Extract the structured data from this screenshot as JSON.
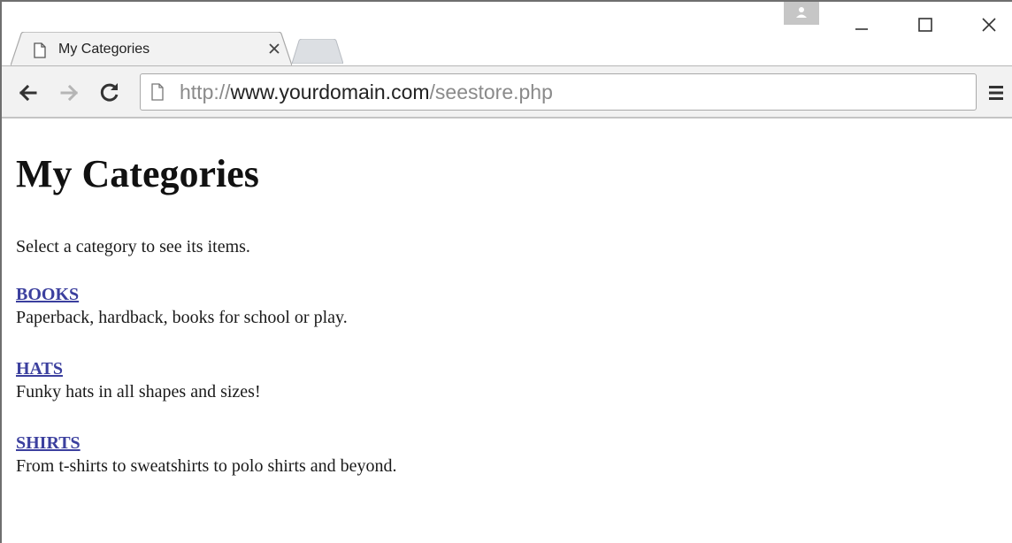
{
  "browser": {
    "tab_title": "My Categories",
    "url": {
      "scheme": "http://",
      "host": "www.yourdomain.com",
      "path": "/seestore.php"
    }
  },
  "page": {
    "title": "My Categories",
    "intro": "Select a category to see its items.",
    "categories": [
      {
        "name": "BOOKS",
        "description": "Paperback, hardback, books for school or play."
      },
      {
        "name": "HATS",
        "description": "Funky hats in all shapes and sizes!"
      },
      {
        "name": "SHIRTS",
        "description": "From t-shirts to sweatshirts to polo shirts and beyond."
      }
    ]
  },
  "colors": {
    "link": "#3b3f9e",
    "toolbar_bg": "#f2f2f2",
    "text": "#1a1a1a"
  },
  "icons": {
    "tab_page": "page-icon",
    "tab_close": "close-icon",
    "profile": "user-icon",
    "minimize": "minimize-icon",
    "maximize": "maximize-icon",
    "window_close": "close-icon",
    "back": "arrow-left-icon",
    "forward": "arrow-right-icon",
    "reload": "reload-icon",
    "omnibox_page": "page-icon",
    "menu": "hamburger-menu-icon"
  }
}
